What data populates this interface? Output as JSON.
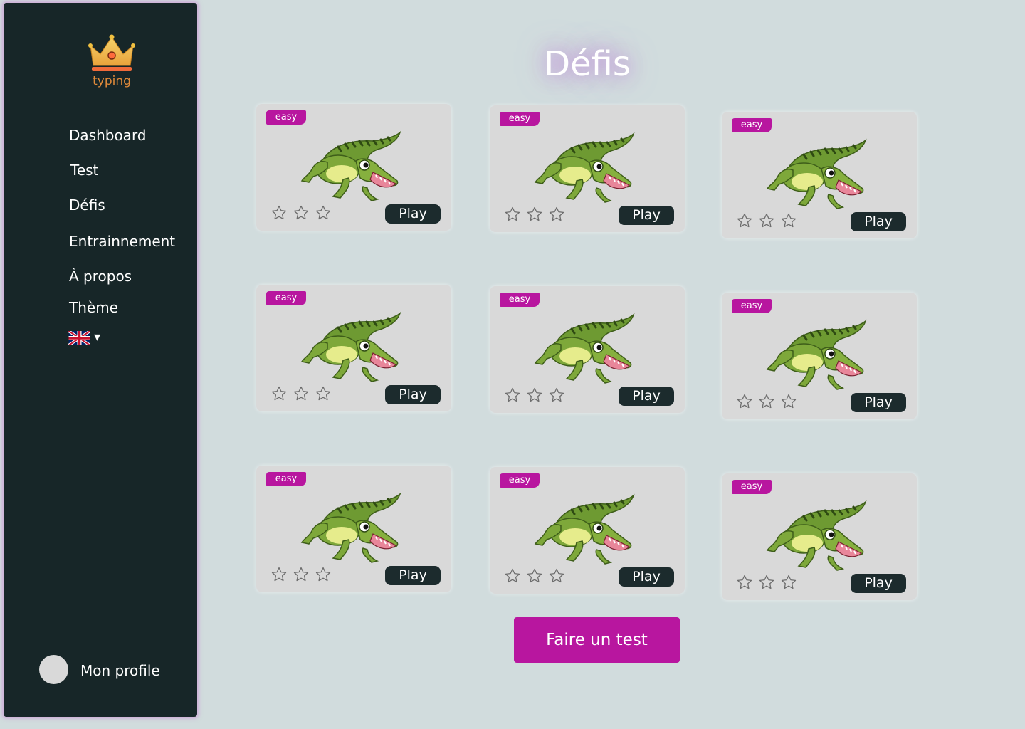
{
  "brand": {
    "logo_text": "typing"
  },
  "sidebar": {
    "items": [
      {
        "label": "Dashboard"
      },
      {
        "label": "Test"
      },
      {
        "label": "Défis"
      },
      {
        "label": "Entrainnement"
      },
      {
        "label": "À propos"
      },
      {
        "label": "Thème"
      }
    ],
    "language": {
      "icon": "uk-flag-icon",
      "caret": "▾"
    },
    "profile": {
      "label": "Mon profile"
    }
  },
  "page": {
    "title": "Défis"
  },
  "challenges": [
    {
      "difficulty": "easy",
      "play_label": "Play",
      "stars": 0
    },
    {
      "difficulty": "easy",
      "play_label": "Play",
      "stars": 0
    },
    {
      "difficulty": "easy",
      "play_label": "Play",
      "stars": 0
    },
    {
      "difficulty": "easy",
      "play_label": "Play",
      "stars": 0
    },
    {
      "difficulty": "easy",
      "play_label": "Play",
      "stars": 0
    },
    {
      "difficulty": "easy",
      "play_label": "Play",
      "stars": 0
    },
    {
      "difficulty": "easy",
      "play_label": "Play",
      "stars": 0
    },
    {
      "difficulty": "easy",
      "play_label": "Play",
      "stars": 0
    },
    {
      "difficulty": "easy",
      "play_label": "Play",
      "stars": 0
    }
  ],
  "cta": {
    "label": "Faire un test"
  },
  "colors": {
    "accent": "#b8169f",
    "sidebar_bg": "#172628",
    "page_bg": "#d1dcdd",
    "card_bg": "#d9d9d9"
  }
}
